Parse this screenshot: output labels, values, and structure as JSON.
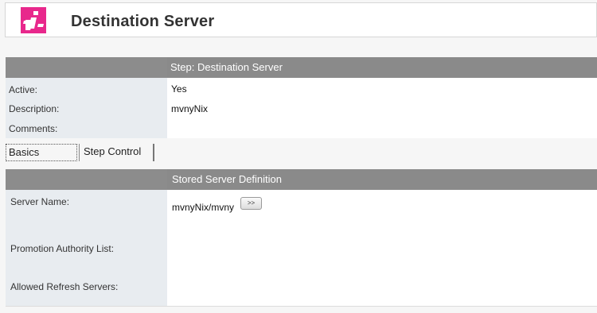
{
  "header": {
    "title": "Destination Server",
    "logo_icon": "info-icon",
    "logo_color": "#e8288c"
  },
  "step_section": {
    "title": "Step:  Destination Server",
    "fields": [
      {
        "label": "Active:",
        "value": "Yes"
      },
      {
        "label": "Description:",
        "value": "mvnyNix"
      },
      {
        "label": "Comments:",
        "value": ""
      }
    ]
  },
  "tabs": [
    {
      "label": "Basics",
      "selected": true
    },
    {
      "label": "Step Control",
      "selected": false
    }
  ],
  "server_section": {
    "title": "Stored Server Definition",
    "server_name_label": "Server Name:",
    "server_name_value": "mvnyNix/mvny",
    "browse_button": ">>",
    "promotion_label": "Promotion Authority List:",
    "refresh_label": "Allowed Refresh Servers:"
  },
  "colors": {
    "section_header": "#8a8a8a",
    "label_column": "#e8ecf0",
    "accent": "#e8288c"
  }
}
